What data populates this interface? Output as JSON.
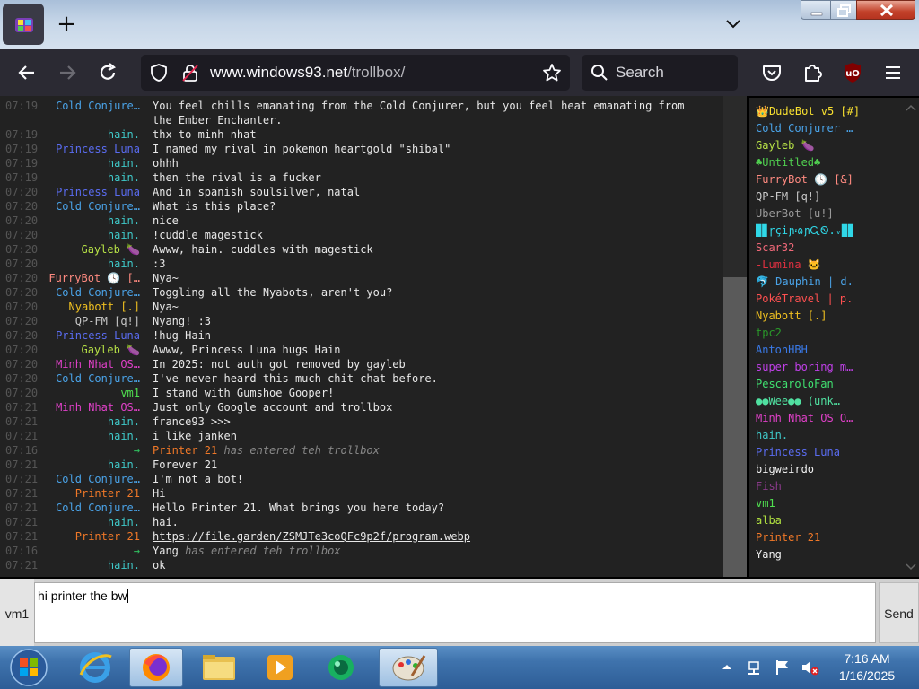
{
  "browser": {
    "new_tab": "+",
    "url_host": "www.windows93.net",
    "url_path": "/trollbox/",
    "search_placeholder": "Search",
    "colors": {
      "tabstrip": "#c6d6e8",
      "toolbar": "#2b2a33",
      "field": "#1c1b22",
      "text": "#fbfbfe"
    }
  },
  "messages": [
    {
      "time": "07:19",
      "nick": "Cold Conjure…",
      "color": "#4aa3e8",
      "text": "You feel chills emanating from the Cold Conjurer, but you feel heat emanating from the Ember Enchanter."
    },
    {
      "time": "07:19",
      "nick": "hain.",
      "color": "#3fc8c8",
      "text": "thx to minh nhat"
    },
    {
      "time": "07:19",
      "nick": "Princess Luna",
      "color": "#5a6cf0",
      "text": "I named my rival in pokemon heartgold \"shibal\""
    },
    {
      "time": "07:19",
      "nick": "hain.",
      "color": "#3fc8c8",
      "text": "ohhh"
    },
    {
      "time": "07:19",
      "nick": "hain.",
      "color": "#3fc8c8",
      "text": "then the rival is a fucker"
    },
    {
      "time": "07:20",
      "nick": "Princess Luna",
      "color": "#5a6cf0",
      "text": "And in spanish soulsilver, natal"
    },
    {
      "time": "07:20",
      "nick": "Cold Conjure…",
      "color": "#4aa3e8",
      "text": "What is this place?"
    },
    {
      "time": "07:20",
      "nick": "hain.",
      "color": "#3fc8c8",
      "text": "nice"
    },
    {
      "time": "07:20",
      "nick": "hain.",
      "color": "#3fc8c8",
      "text": "!cuddle magestick"
    },
    {
      "time": "07:20",
      "nick": "Gayleb 🍆",
      "color": "#b6e046",
      "text": "Awww, hain. cuddles with magestick"
    },
    {
      "time": "07:20",
      "nick": "hain.",
      "color": "#3fc8c8",
      "text": ":3"
    },
    {
      "time": "07:20",
      "nick": "FurryBot 🕓 […",
      "color": "#ff8a80",
      "text": "Nya~"
    },
    {
      "time": "07:20",
      "nick": "Cold Conjure…",
      "color": "#4aa3e8",
      "text": "Toggling all the Nyabots, aren't you?"
    },
    {
      "time": "07:20",
      "nick": "Nyabott [.]",
      "color": "#f0c020",
      "text": "Nya~"
    },
    {
      "time": "07:20",
      "nick": "QP-FM [q!]",
      "color": "#c8c8c8",
      "text": "Nyang! :3"
    },
    {
      "time": "07:20",
      "nick": "Princess Luna",
      "color": "#5a6cf0",
      "text": "!hug Hain"
    },
    {
      "time": "07:20",
      "nick": "Gayleb 🍆",
      "color": "#b6e046",
      "text": "Awww, Princess Luna hugs Hain"
    },
    {
      "time": "07:20",
      "nick": "Minh Nhat OS…",
      "color": "#e040c8",
      "text": "In 2025: not auth got removed by gayleb"
    },
    {
      "time": "07:20",
      "nick": "Cold Conjure…",
      "color": "#4aa3e8",
      "text": "I've never heard this much chit-chat before."
    },
    {
      "time": "07:20",
      "nick": "vm1",
      "color": "#50e050",
      "text": "I stand with Gumshoe Gooper!"
    },
    {
      "time": "07:21",
      "nick": "Minh Nhat OS…",
      "color": "#e040c8",
      "text": "Just only Google account and trollbox"
    },
    {
      "time": "07:21",
      "nick": "hain.",
      "color": "#3fc8c8",
      "text": "france93 >>>"
    },
    {
      "time": "07:21",
      "nick": "hain.",
      "color": "#3fc8c8",
      "text": "i like janken"
    },
    {
      "time": "07:16",
      "nick": "→",
      "color": "#30c060",
      "who": "Printer 21",
      "who_color": "#f07828",
      "text": "has entered teh trollbox",
      "system": true
    },
    {
      "time": "07:21",
      "nick": "hain.",
      "color": "#3fc8c8",
      "text": "Forever 21"
    },
    {
      "time": "07:21",
      "nick": "Cold Conjure…",
      "color": "#4aa3e8",
      "text": "I'm not a bot!"
    },
    {
      "time": "07:21",
      "nick": "Printer 21",
      "color": "#f07828",
      "text": "Hi"
    },
    {
      "time": "07:21",
      "nick": "Cold Conjure…",
      "color": "#4aa3e8",
      "text": "Hello Printer 21. What brings you here today?"
    },
    {
      "time": "07:21",
      "nick": "hain.",
      "color": "#3fc8c8",
      "text": "hai."
    },
    {
      "time": "07:21",
      "nick": "Printer 21",
      "color": "#f07828",
      "text": "https://file.garden/ZSMJTe3coQFc9p2f/program.webp",
      "link": true
    },
    {
      "time": "07:16",
      "nick": "→",
      "color": "#30c060",
      "who": "Yang",
      "who_color": "#e8e8e8",
      "text": "has entered teh trollbox",
      "system": true
    },
    {
      "time": "07:21",
      "nick": "hain.",
      "color": "#3fc8c8",
      "text": "ok"
    }
  ],
  "users": [
    {
      "name": "👑DudeBot v5 [#]",
      "color": "#f8e030"
    },
    {
      "name": "Cold Conjurer …",
      "color": "#4aa3e8"
    },
    {
      "name": "Gayleb 🍆",
      "color": "#b6e046"
    },
    {
      "name": "♣Untitled♣",
      "color": "#50d050"
    },
    {
      "name": "FurryBot 🕓 [&]",
      "color": "#ff8a80"
    },
    {
      "name": "QP-FM [q!]",
      "color": "#c8c8c8"
    },
    {
      "name": "UberBot [u!]",
      "color": "#9a9a9a"
    },
    {
      "name": "▉▊ɼçɨɲ፡ɷɲᏩᏫ.ᵥ▉▊",
      "color": "#30d8e8"
    },
    {
      "name": "Scar32",
      "color": "#f06878"
    },
    {
      "name": "-Lumina 🐱",
      "color": "#e03040"
    },
    {
      "name": "🐬 Dauphin | d.",
      "color": "#4aa3e8"
    },
    {
      "name": "PokéTravel | p.",
      "color": "#ff5050"
    },
    {
      "name": "Nyabott [.]",
      "color": "#f0c020"
    },
    {
      "name": "tpc2",
      "color": "#2a9a2a"
    },
    {
      "name": "AntonHBH",
      "color": "#3a7ae8"
    },
    {
      "name": "super boring m…",
      "color": "#c040e8"
    },
    {
      "name": "PescaroloFan",
      "color": "#40e070"
    },
    {
      "name": "●●Wee●● (unk…",
      "color": "#50e0a0"
    },
    {
      "name": "Minh Nhat OS O…",
      "color": "#e040c8"
    },
    {
      "name": "hain.",
      "color": "#3fc8c8"
    },
    {
      "name": "Princess Luna",
      "color": "#5a6cf0"
    },
    {
      "name": "bigweirdo",
      "color": "#f0f0f0"
    },
    {
      "name": "Fish",
      "color": "#8a3a8a"
    },
    {
      "name": "vm1",
      "color": "#50e050"
    },
    {
      "name": "alba",
      "color": "#b0e040"
    },
    {
      "name": "Printer 21",
      "color": "#f07828"
    },
    {
      "name": "Yang",
      "color": "#f0f0f0"
    }
  ],
  "input": {
    "nick": "vm1",
    "value": "hi printer the bw",
    "send_label": "Send"
  },
  "taskbar": {
    "time": "7:16 AM",
    "date": "1/16/2025"
  }
}
